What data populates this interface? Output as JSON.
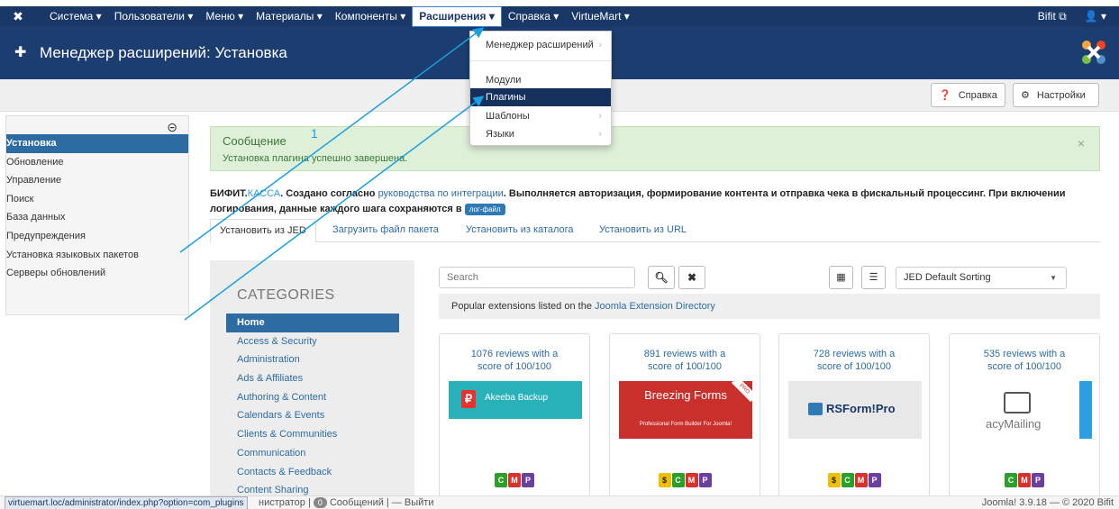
{
  "topnav": {
    "menu": [
      {
        "label": "Система ▾"
      },
      {
        "label": "Пользователи ▾"
      },
      {
        "label": "Меню ▾"
      },
      {
        "label": "Материалы ▾"
      },
      {
        "label": "Компоненты ▾"
      },
      {
        "label": "Расширения ▾",
        "active": true
      },
      {
        "label": "Справка ▾"
      },
      {
        "label": "VirtueMart ▾"
      }
    ],
    "site": "Bifit ⧉",
    "user": "👤 ▾"
  },
  "title": {
    "text": "Менеджер расширений: Установка"
  },
  "toolbar": {
    "help": "Справка",
    "options": "Настройки"
  },
  "sidebar": {
    "items": [
      {
        "label": "Установка",
        "active": true
      },
      {
        "label": "Обновление"
      },
      {
        "label": "Управление"
      },
      {
        "label": "Поиск"
      },
      {
        "label": "База данных"
      },
      {
        "label": "Предупреждения"
      },
      {
        "label": "Установка языковых пакетов"
      },
      {
        "label": "Серверы обновлений"
      }
    ]
  },
  "dropdown": {
    "items": [
      {
        "label": "Менеджер расширений",
        "chevron": true
      },
      {
        "label": "Модули"
      },
      {
        "label": "Плагины",
        "active": true
      },
      {
        "label": "Шаблоны",
        "chevron": true
      },
      {
        "label": "Языки",
        "chevron": true
      }
    ]
  },
  "message": {
    "heading": "Сообщение",
    "body": "Установка плагина успешно завершена.",
    "close": "×"
  },
  "desc": {
    "brand1": "БИФИТ.",
    "brand2": "КАССА",
    "t1": ". Создано согласно ",
    "link": "руководства по интеграции",
    "t2": ". Выполняется авторизация, формирование контента и отправка чека в фискальный процессинг. При включении логирования, данные каждого шага сохраняются в ",
    "badge": "лог-файл"
  },
  "tabs": [
    {
      "label": "Установить из JED",
      "active": true
    },
    {
      "label": "Загрузить файл пакета"
    },
    {
      "label": "Установить из каталога"
    },
    {
      "label": "Установить из URL"
    }
  ],
  "categories": {
    "heading": "CATEGORIES",
    "items": [
      {
        "label": "Home",
        "active": true
      },
      {
        "label": "Access & Security"
      },
      {
        "label": "Administration"
      },
      {
        "label": "Ads & Affiliates"
      },
      {
        "label": "Authoring & Content"
      },
      {
        "label": "Calendars & Events"
      },
      {
        "label": "Clients & Communities"
      },
      {
        "label": "Communication"
      },
      {
        "label": "Contacts & Feedback"
      },
      {
        "label": "Content Sharing"
      }
    ]
  },
  "search": {
    "placeholder": "Search"
  },
  "sort": {
    "value": "JED Default Sorting"
  },
  "popular": {
    "text": "Popular extensions listed on the ",
    "link": "Joomla Extension Directory"
  },
  "cards": [
    {
      "reviews": "1076 reviews with a",
      "score": "score of 100/100",
      "name": "Akeeba Backup",
      "icons": [
        "C",
        "M",
        "P"
      ]
    },
    {
      "reviews": "891 reviews with a",
      "score": "score of 100/100",
      "name": "Breezing Forms",
      "tagline": "Professional Form Builder For Joomla!",
      "ribbon": "PRO",
      "icons": [
        "$",
        "C",
        "M",
        "P"
      ]
    },
    {
      "reviews": "728 reviews with a",
      "score": "score of 100/100",
      "name": "RSForm!Pro",
      "icons": [
        "$",
        "C",
        "M",
        "P"
      ]
    },
    {
      "reviews": "535 reviews with a",
      "score": "score of 100/100",
      "name": "acyMailing",
      "icons": [
        "C",
        "M",
        "P"
      ]
    }
  ],
  "statusbar": {
    "url": "virtuemart.loc/administrator/index.php?option=com_plugins",
    "admin": "нистратор",
    "messages_count": "0",
    "messages": "Сообщений",
    "logout": "— Выйти",
    "version": "Joomla! 3.9.18 — © 2020 Bifit"
  },
  "annotation": {
    "label": "1"
  },
  "colors": {
    "nav": "#1a3867",
    "accent": "#2d6ca2",
    "success_bg": "#dff0d8",
    "arrow": "#1a9fe0"
  }
}
